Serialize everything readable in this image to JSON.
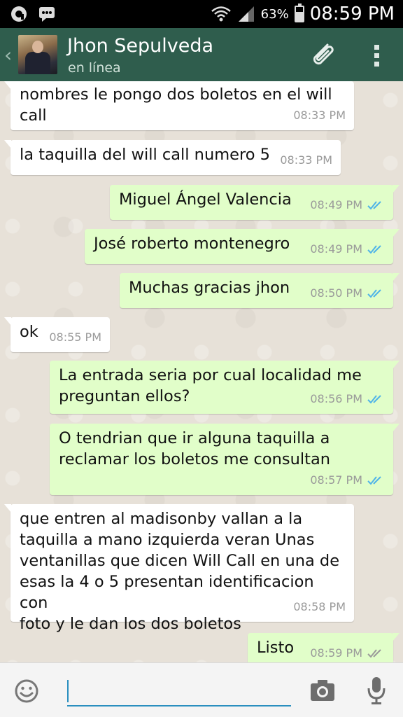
{
  "status_bar": {
    "battery_percent": "63%",
    "time": "08:59 PM",
    "battery_level": 0.63
  },
  "header": {
    "contact_name": "Jhon Sepulveda",
    "contact_status": "en línea"
  },
  "messages": [
    {
      "text": "nombres le pongo dos boletos en el will\ncall",
      "time": "08:33 PM"
    },
    {
      "text": "la taquilla del will call numero 5",
      "time": "08:33 PM"
    },
    {
      "text": "Miguel Ángel Valencia",
      "time": "08:49 PM"
    },
    {
      "text": "José roberto montenegro",
      "time": "08:49 PM"
    },
    {
      "text": "Muchas gracias jhon",
      "time": "08:50 PM"
    },
    {
      "text": "ok",
      "time": "08:55 PM"
    },
    {
      "text": "La entrada seria por cual localidad me\npreguntan ellos?",
      "time": "08:56 PM"
    },
    {
      "text": "O tendrian que ir alguna taquilla a\nreclamar los boletos me consultan",
      "time": "08:57 PM"
    },
    {
      "text": "que entren al madisonby vallan a la\ntaquilla a mano izquierda veran Unas\nventanillas que dicen Will Call en una de\nesas la 4 o 5 presentan identificacion con\nfoto y le dan los dos boletos",
      "time": "08:58 PM"
    },
    {
      "text": "Listo",
      "time": "08:59 PM"
    }
  ],
  "input": {
    "value": ""
  },
  "colors": {
    "header_bg": "#2f5d4d",
    "outgoing_bubble": "#e1fec9",
    "incoming_bubble": "#ffffff",
    "read_ticks": "#4fb3e8",
    "delivered_ticks": "#9a9a9a",
    "input_accent": "#2a8fbf"
  }
}
